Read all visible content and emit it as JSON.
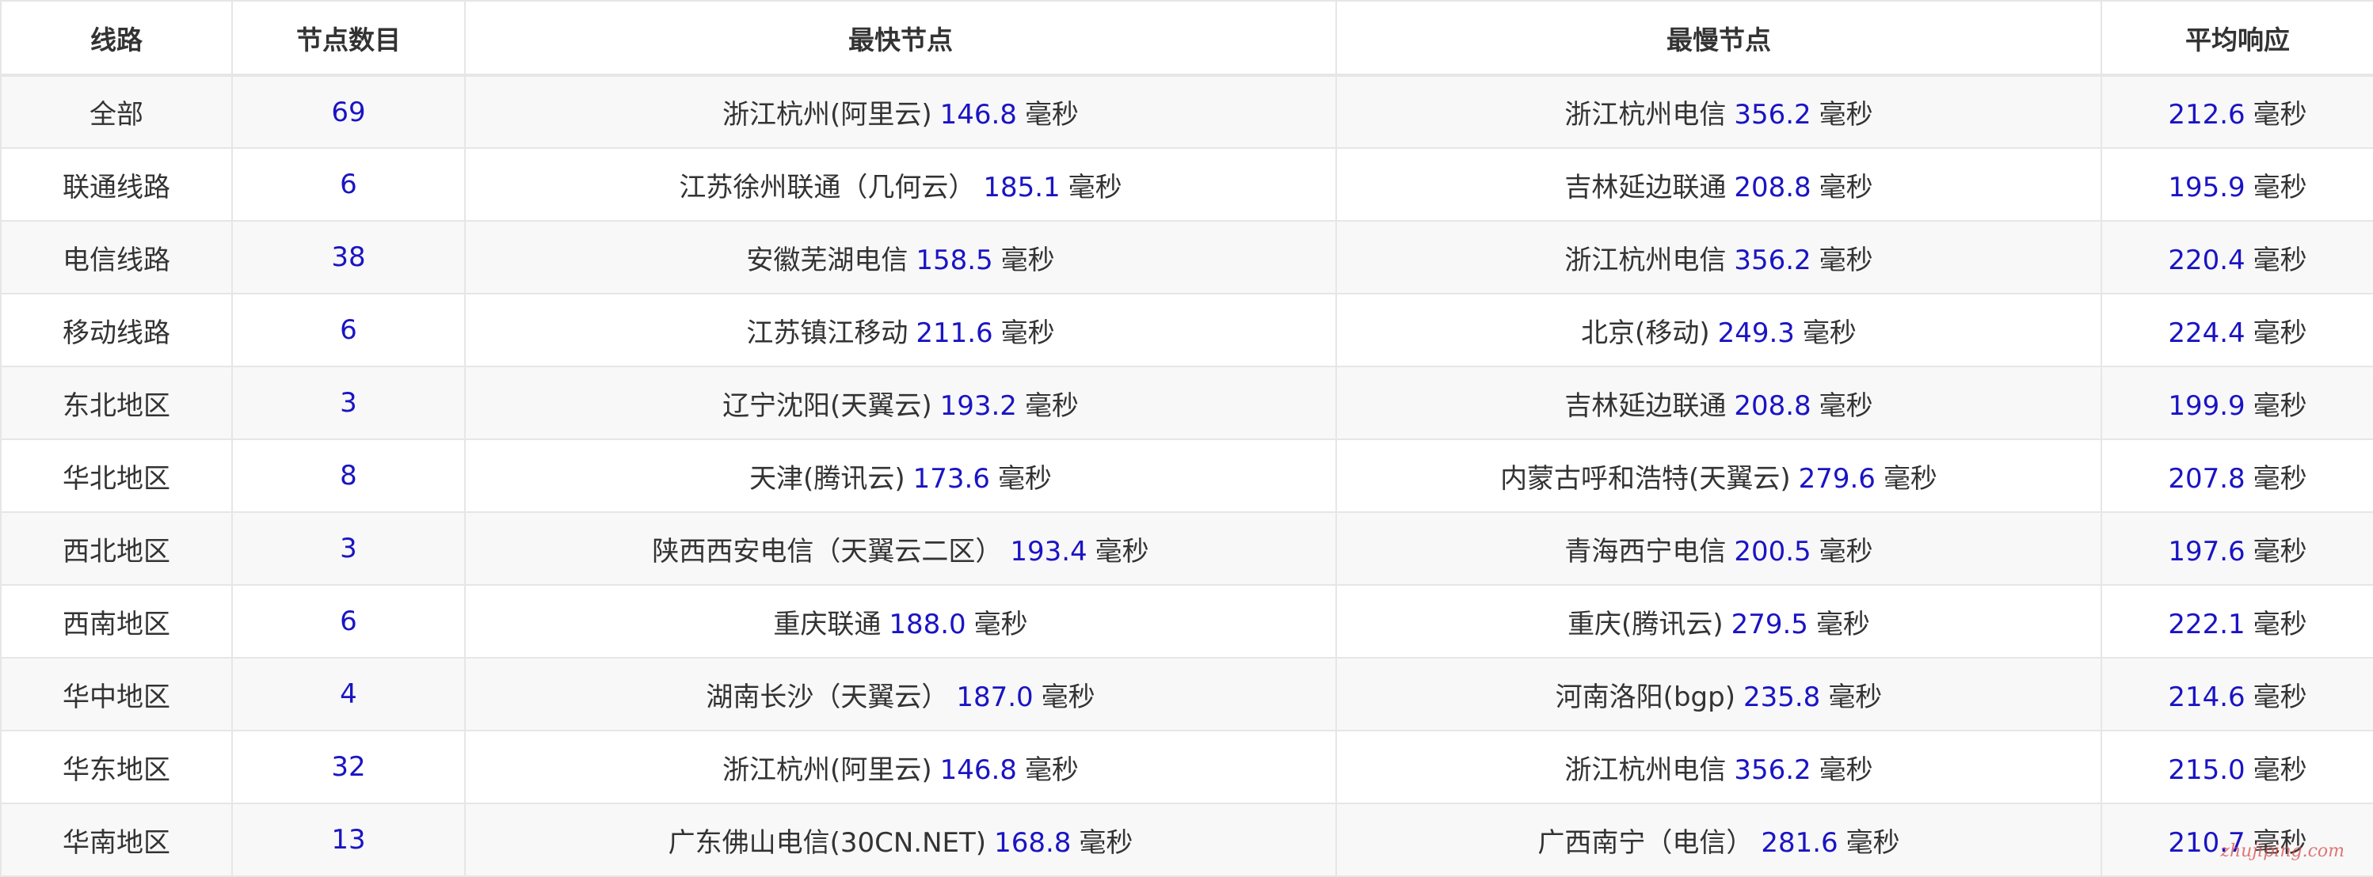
{
  "headers": {
    "line": "线路",
    "count": "节点数目",
    "fastest": "最快节点",
    "slowest": "最慢节点",
    "average": "平均响应"
  },
  "unit": "毫秒",
  "watermark": "zhujiping.com",
  "rows": [
    {
      "line": "全部",
      "count": "69",
      "fast_name": "浙江杭州(阿里云)",
      "fast_ms": "146.8",
      "slow_name": "浙江杭州电信",
      "slow_ms": "356.2",
      "avg_ms": "212.6"
    },
    {
      "line": "联通线路",
      "count": "6",
      "fast_name": "江苏徐州联通（几何云）",
      "fast_ms": "185.1",
      "slow_name": "吉林延边联通",
      "slow_ms": "208.8",
      "avg_ms": "195.9"
    },
    {
      "line": "电信线路",
      "count": "38",
      "fast_name": "安徽芜湖电信",
      "fast_ms": "158.5",
      "slow_name": "浙江杭州电信",
      "slow_ms": "356.2",
      "avg_ms": "220.4"
    },
    {
      "line": "移动线路",
      "count": "6",
      "fast_name": "江苏镇江移动",
      "fast_ms": "211.6",
      "slow_name": "北京(移动)",
      "slow_ms": "249.3",
      "avg_ms": "224.4"
    },
    {
      "line": "东北地区",
      "count": "3",
      "fast_name": "辽宁沈阳(天翼云)",
      "fast_ms": "193.2",
      "slow_name": "吉林延边联通",
      "slow_ms": "208.8",
      "avg_ms": "199.9"
    },
    {
      "line": "华北地区",
      "count": "8",
      "fast_name": "天津(腾讯云)",
      "fast_ms": "173.6",
      "slow_name": "内蒙古呼和浩特(天翼云)",
      "slow_ms": "279.6",
      "avg_ms": "207.8"
    },
    {
      "line": "西北地区",
      "count": "3",
      "fast_name": "陕西西安电信（天翼云二区）",
      "fast_ms": "193.4",
      "slow_name": "青海西宁电信",
      "slow_ms": "200.5",
      "avg_ms": "197.6"
    },
    {
      "line": "西南地区",
      "count": "6",
      "fast_name": "重庆联通",
      "fast_ms": "188.0",
      "slow_name": "重庆(腾讯云)",
      "slow_ms": "279.5",
      "avg_ms": "222.1"
    },
    {
      "line": "华中地区",
      "count": "4",
      "fast_name": "湖南长沙（天翼云）",
      "fast_ms": "187.0",
      "slow_name": "河南洛阳(bgp)",
      "slow_ms": "235.8",
      "avg_ms": "214.6"
    },
    {
      "line": "华东地区",
      "count": "32",
      "fast_name": "浙江杭州(阿里云)",
      "fast_ms": "146.8",
      "slow_name": "浙江杭州电信",
      "slow_ms": "356.2",
      "avg_ms": "215.0"
    },
    {
      "line": "华南地区",
      "count": "13",
      "fast_name": "广东佛山电信(30CN.NET)",
      "fast_ms": "168.8",
      "slow_name": "广西南宁（电信）",
      "slow_ms": "281.6",
      "avg_ms": "210.7"
    }
  ]
}
